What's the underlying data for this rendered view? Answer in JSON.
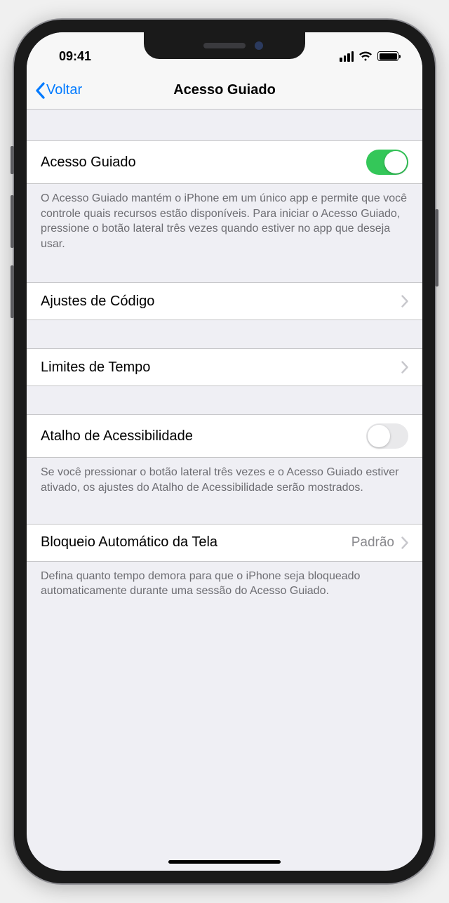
{
  "status": {
    "time": "09:41"
  },
  "nav": {
    "back": "Voltar",
    "title": "Acesso Guiado"
  },
  "main_toggle": {
    "label": "Acesso Guiado",
    "on": true,
    "footer": "O Acesso Guiado mantém o iPhone em um único app e permite que você controle quais recursos estão disponíveis. Para iniciar o Acesso Guiado, pressione o botão lateral três vezes quando estiver no app que deseja usar."
  },
  "passcode": {
    "label": "Ajustes de Código"
  },
  "time_limits": {
    "label": "Limites de Tempo"
  },
  "shortcut": {
    "label": "Atalho de Acessibilidade",
    "on": false,
    "footer": "Se você pressionar o botão lateral três vezes e o Acesso Guiado estiver ativado, os ajustes do Atalho de Acessibilidade serão mostrados."
  },
  "autolock": {
    "label": "Bloqueio Automático da Tela",
    "value": "Padrão",
    "footer": "Defina quanto tempo demora para que o iPhone seja bloqueado automaticamente durante uma sessão do Acesso Guiado."
  }
}
